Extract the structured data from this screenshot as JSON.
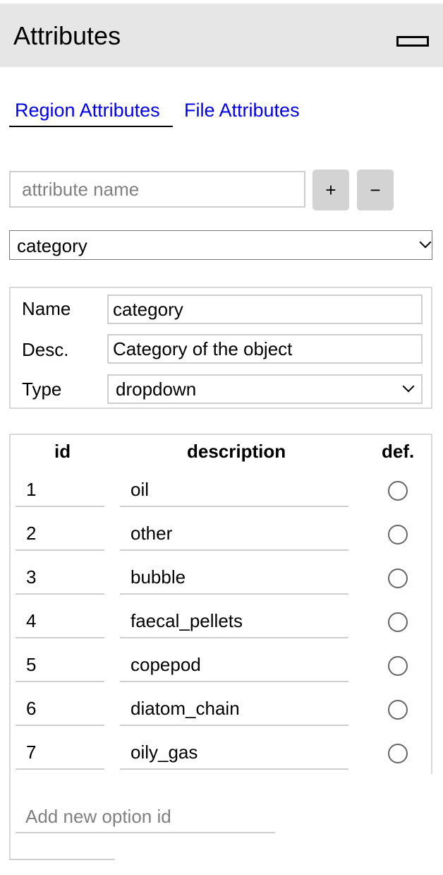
{
  "header": {
    "title": "Attributes",
    "minimize_icon": "minimize-icon"
  },
  "tabs": [
    {
      "label": "Region Attributes",
      "active": true
    },
    {
      "label": "File Attributes",
      "active": false
    }
  ],
  "attribute_input": {
    "value": "",
    "placeholder": "attribute name"
  },
  "buttons": {
    "add_label": "+",
    "remove_label": "−"
  },
  "attribute_select": {
    "selected": "category"
  },
  "properties": {
    "name_label": "Name",
    "name_value": "category",
    "desc_label": "Desc.",
    "desc_value": "Category of the object",
    "type_label": "Type",
    "type_value": "dropdown"
  },
  "options": {
    "headers": {
      "id": "id",
      "description": "description",
      "default": "def."
    },
    "rows": [
      {
        "id": "1",
        "description": "oil"
      },
      {
        "id": "2",
        "description": "other"
      },
      {
        "id": "3",
        "description": "bubble"
      },
      {
        "id": "4",
        "description": "faecal_pellets"
      },
      {
        "id": "5",
        "description": "copepod"
      },
      {
        "id": "6",
        "description": "diatom_chain"
      },
      {
        "id": "7",
        "description": "oily_gas"
      }
    ],
    "new_option_placeholder": "Add new option id"
  },
  "colors": {
    "header_bg": "#e6e6e6",
    "link": "#0000ee",
    "button_bg": "#d3d3d3",
    "border": "#cfcfcf"
  }
}
